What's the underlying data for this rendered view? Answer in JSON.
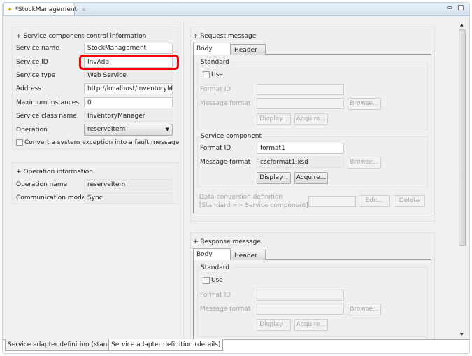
{
  "editor_tab": {
    "title": "*StockManagement",
    "close_icon": "close-icon"
  },
  "control": {
    "title": "+ Service component control information",
    "service_name_label": "Service name",
    "service_name": "StockManagement",
    "service_id_label": "Service ID",
    "service_id": "InvAdp",
    "service_type_label": "Service type",
    "service_type": "Web Service",
    "address_label": "Address",
    "address": "http://localhost/InventoryMana",
    "max_instances_label": "Maximum instances",
    "max_instances": "0",
    "class_name_label": "Service class name",
    "class_name": "InventoryManager",
    "operation_label": "Operation",
    "operation": "reserveItem",
    "convert_label": "Convert a system exception into a fault message",
    "convert_checked": false
  },
  "operation_info": {
    "title": "+ Operation information",
    "name_label": "Operation name",
    "name": "reserveItem",
    "model_label": "Communication model",
    "model": "Sync"
  },
  "request": {
    "title": "+ Request message",
    "tabs": [
      "Body",
      "Header"
    ],
    "standard": {
      "title": "Standard",
      "use_label": "Use",
      "format_id_label": "Format ID",
      "message_format_label": "Message format",
      "browse": "Browse...",
      "display": "Display...",
      "acquire": "Acquire..."
    },
    "service_component": {
      "title": "Service component",
      "format_id_label": "Format ID",
      "format_id": "format1",
      "message_format_label": "Message format",
      "message_format": "cscformat1.xsd",
      "browse": "Browse...",
      "display": "Display...",
      "acquire": "Acquire..."
    },
    "conversion": {
      "label1": "Data-conversion definition",
      "label2": "[Standard => Service component]",
      "edit": "Edit...",
      "delete": "Delete"
    }
  },
  "response": {
    "title": "+ Response message",
    "tabs": [
      "Body",
      "Header"
    ],
    "standard": {
      "title": "Standard",
      "use_label": "Use",
      "format_id_label": "Format ID",
      "message_format_label": "Message format",
      "browse": "Browse...",
      "display": "Display...",
      "acquire": "Acquire..."
    }
  },
  "bottom_tabs": [
    "Service adapter definition (standard)",
    "Service adapter definition (details)"
  ],
  "colors": {
    "highlight": "#ff0000"
  }
}
